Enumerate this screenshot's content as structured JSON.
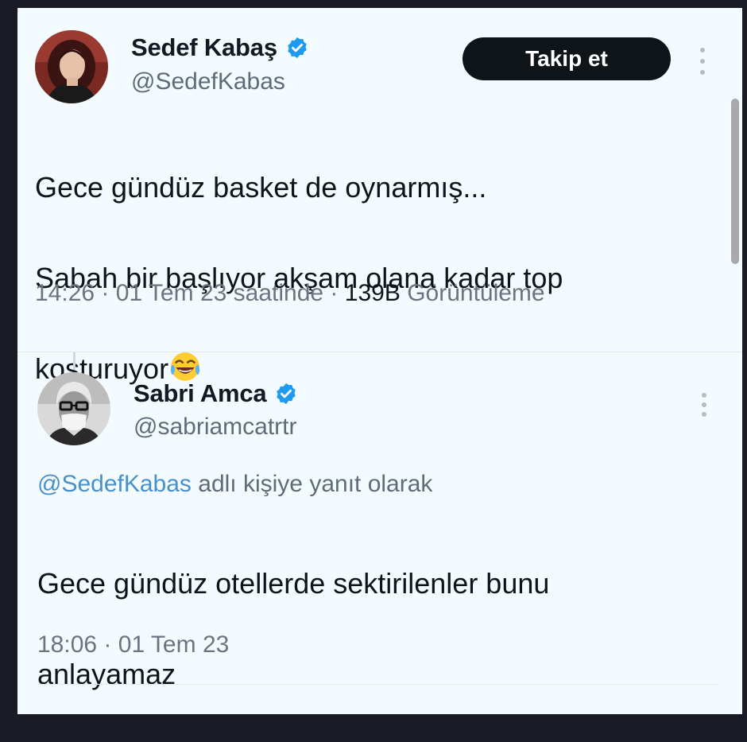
{
  "tweet": {
    "author_name": "Sedef Kabaş",
    "author_handle": "@SedefKabas",
    "follow_label": "Takip et",
    "text_line1": "Gece gündüz basket de oynarmış...",
    "text_line2": "Sabah bir başlıyor akşam olana kadar top",
    "text_line3": "koşturuyor",
    "emoji_icon": "face-with-tears-of-joy",
    "time": "14:26",
    "date": "01 Tem 23 saatinde",
    "views_count": "139B",
    "views_label": "Görüntüleme"
  },
  "reply": {
    "author_name": "Sabri Amca",
    "author_handle": "@sabriamcatrtr",
    "reply_to_mention": "@SedefKabas",
    "reply_to_suffix": "adlı kişiye yanıt olarak",
    "text_line1": "Gece gündüz otellerde sektirilenler bunu",
    "text_line2": "anlayamaz",
    "time": "18:06",
    "date": "01 Tem 23"
  },
  "colors": {
    "background": "#f3fbff",
    "follow_button": "#0f1419",
    "verified_badge": "#1d9bf0",
    "mention": "#4a90c8"
  },
  "separator": "·"
}
